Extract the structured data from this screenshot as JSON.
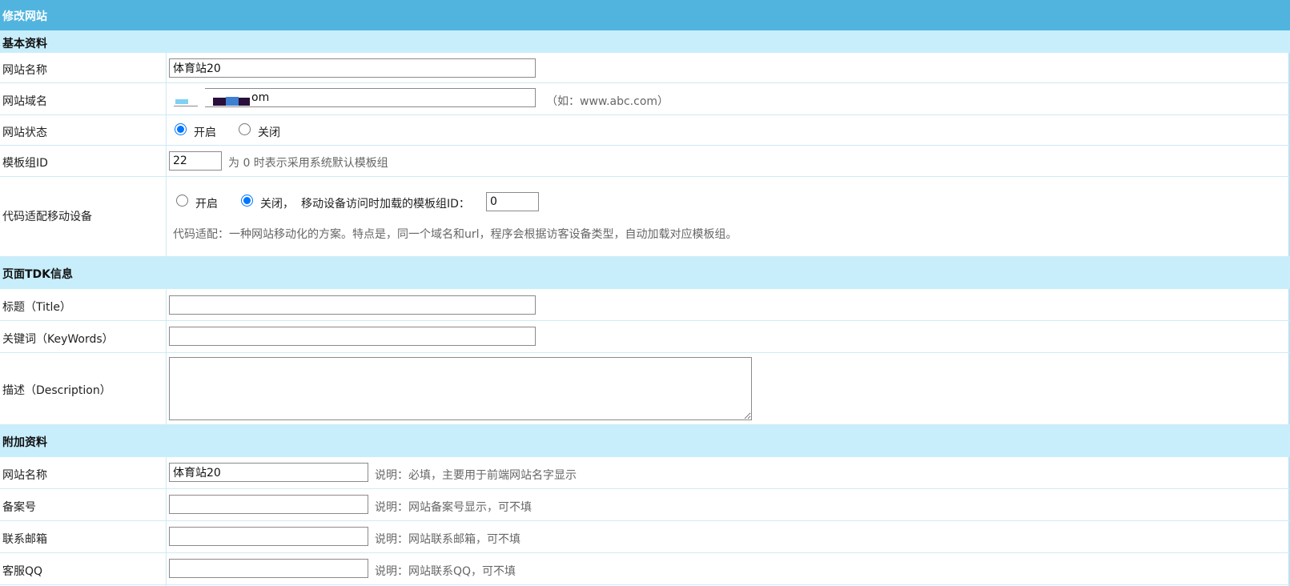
{
  "header": {
    "title": "修改网站"
  },
  "sections": {
    "basic": "基本资料",
    "tdk": "页面TDK信息",
    "extra": "附加资料"
  },
  "basic": {
    "site_name": {
      "label": "网站名称",
      "value": "体育站20"
    },
    "domain": {
      "label": "网站域名",
      "value_visible_suffix": "om",
      "hint": "（如：www.abc.com）"
    },
    "status": {
      "label": "网站状态",
      "option_on": "开启",
      "option_off": "关闭",
      "selected": "开启"
    },
    "template": {
      "label": "模板组ID",
      "value": "22",
      "hint": "为 0 时表示采用系统默认模板组"
    },
    "mobile": {
      "label": "代码适配移动设备",
      "option_on": "开启",
      "option_off": "关闭，",
      "selected": "关闭，",
      "mobile_template_label": "移动设备访问时加载的模板组ID：",
      "mobile_template_value": "0",
      "description": "代码适配：一种网站移动化的方案。特点是，同一个域名和url，程序会根据访客设备类型，自动加载对应模板组。"
    }
  },
  "tdk": {
    "title": {
      "label": "标题（Title）",
      "value": ""
    },
    "keywords": {
      "label": "关键词（KeyWords）",
      "value": ""
    },
    "description": {
      "label": "描述（Description）",
      "value": ""
    }
  },
  "extra": {
    "site_name": {
      "label": "网站名称",
      "value": "体育站20",
      "hint": "说明：必填，主要用于前端网站名字显示"
    },
    "icp": {
      "label": "备案号",
      "value": "",
      "hint": "说明：网站备案号显示，可不填"
    },
    "email": {
      "label": "联系邮箱",
      "value": "",
      "hint": "说明：网站联系邮箱，可不填"
    },
    "qq": {
      "label": "客服QQ",
      "value": "",
      "hint": "说明：网站联系QQ，可不填"
    }
  },
  "colors": {
    "header_bg": "#50b4df",
    "section_bg": "#c8eefc",
    "divider": "#cdebf5"
  }
}
